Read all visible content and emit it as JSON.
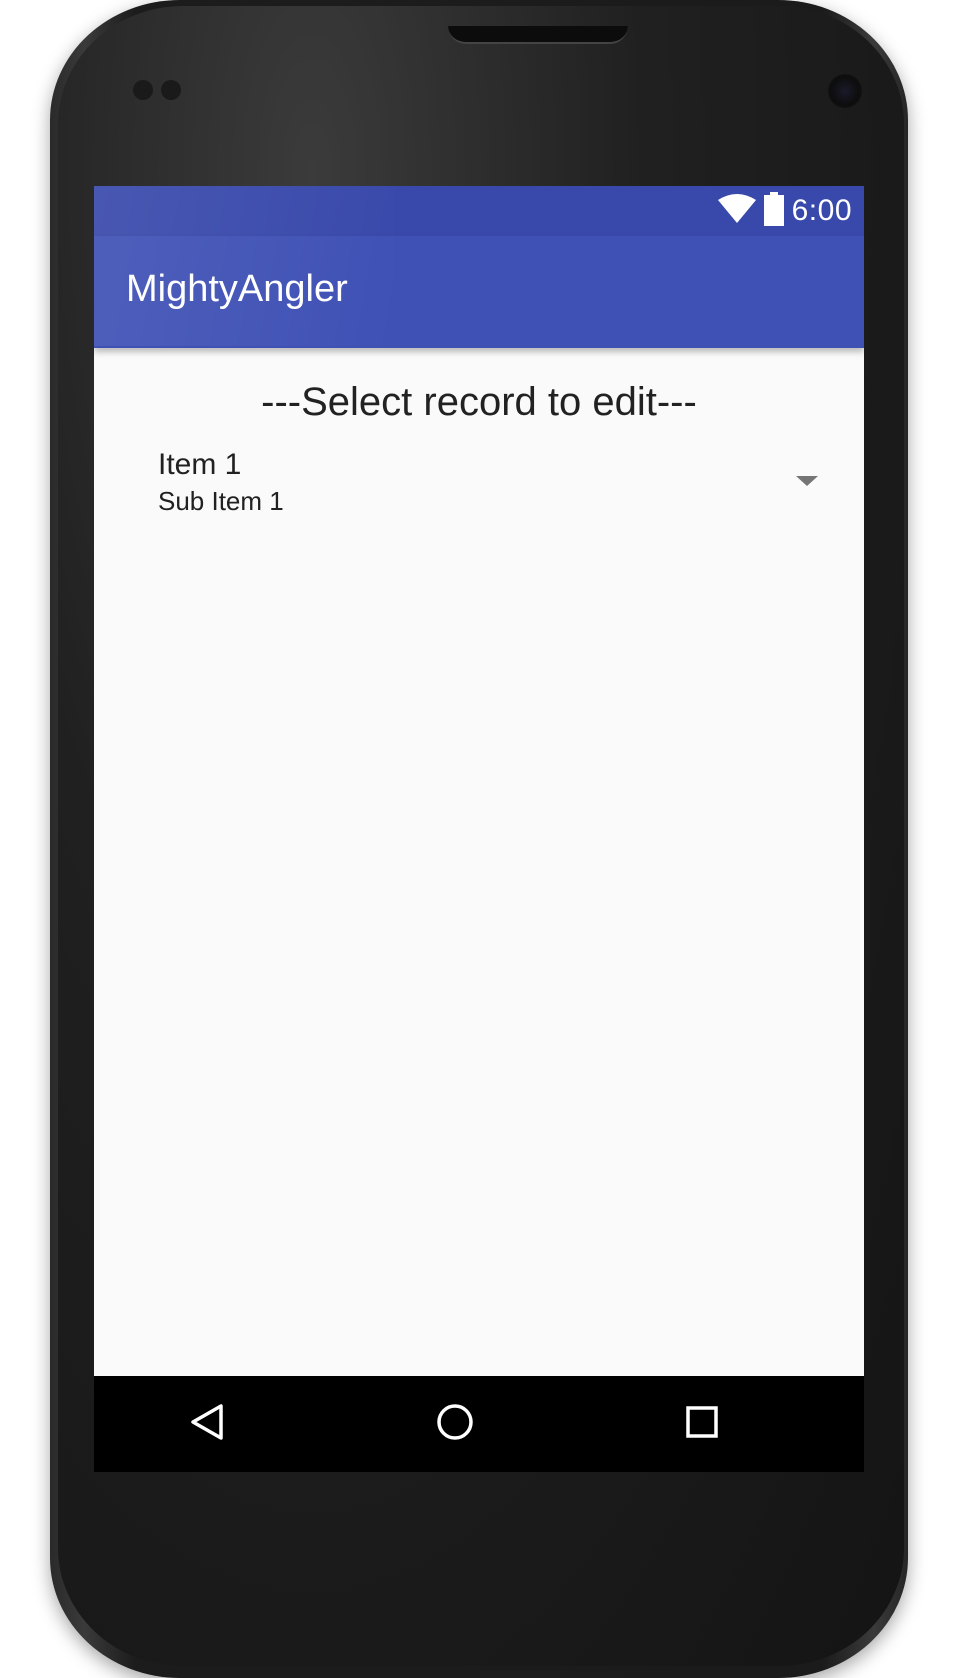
{
  "status_bar": {
    "time": "6:00",
    "icons": [
      "wifi-icon",
      "battery-icon"
    ]
  },
  "app_bar": {
    "title": "MightyAngler"
  },
  "content": {
    "heading": "---Select record to edit---",
    "spinner": {
      "title": "Item 1",
      "subtitle": "Sub Item 1"
    }
  },
  "nav_bar": {
    "buttons": [
      "back-icon",
      "home-icon",
      "recents-icon"
    ]
  },
  "colors": {
    "status_bar": "#3949ab",
    "app_bar": "#3f51b5",
    "background": "#fafafa",
    "nav_bar": "#000000"
  }
}
